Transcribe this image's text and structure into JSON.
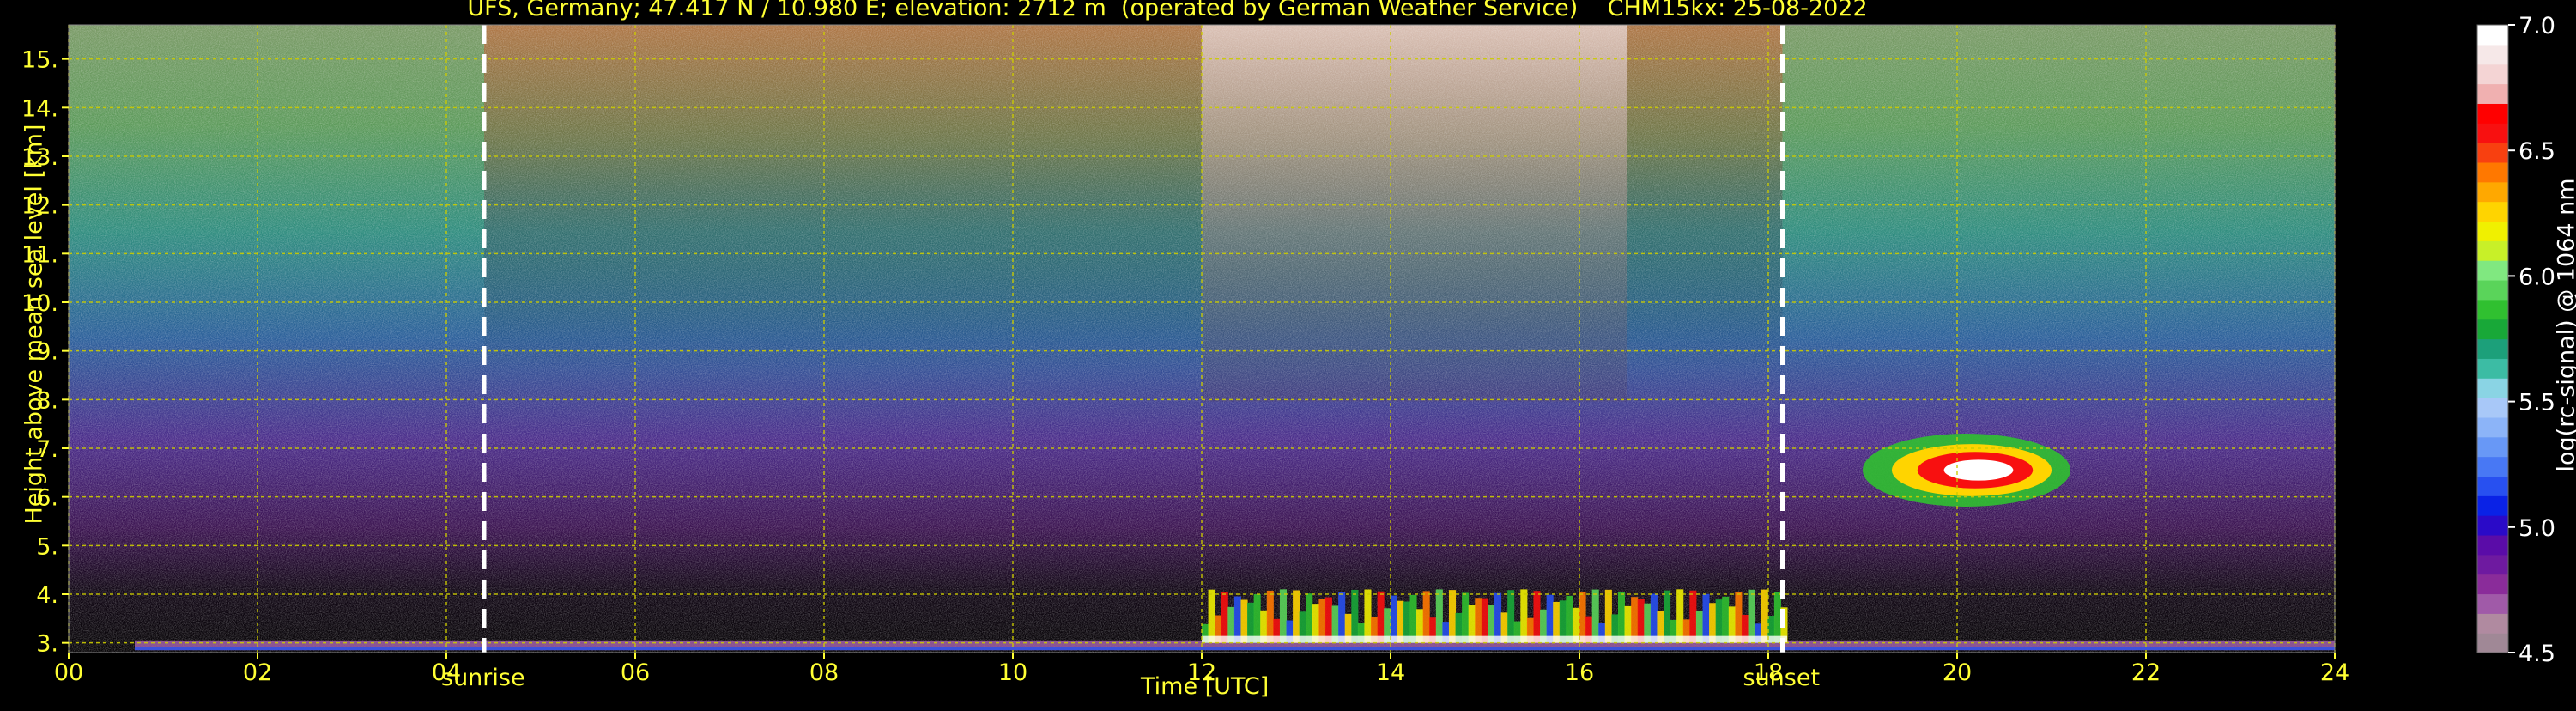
{
  "chart_data": {
    "type": "heatmap",
    "title": "UFS, Germany; 47.417 N / 10.980 E; elevation: 2712 m  (operated by German Weather Service)    CHM15kx: 25-08-2022",
    "xlabel": "Time [UTC]",
    "ylabel": "Height above mean sea level [km]",
    "colorbar_label": "log(rc-signal) @ 1064 nm",
    "x_range": [
      0,
      24
    ],
    "y_range": [
      2.8,
      15.7
    ],
    "x_ticks": [
      "00",
      "02",
      "04",
      "06",
      "08",
      "10",
      "12",
      "14",
      "16",
      "18",
      "20",
      "22",
      "24"
    ],
    "y_ticks": [
      "3.",
      "4.",
      "5.",
      "6.",
      "7.",
      "8.",
      "9.",
      "10.",
      "11.",
      "12.",
      "13.",
      "14.",
      "15."
    ],
    "colorbar_range": [
      4.5,
      7.0
    ],
    "colorbar_ticks": [
      "4.5",
      "5.0",
      "5.5",
      "6.0",
      "6.5",
      "7.0"
    ],
    "colorbar_colors": [
      "#a08896",
      "#b08aa0",
      "#a05aa8",
      "#8a2c9a",
      "#6e1aa0",
      "#5a0ca8",
      "#2a0ac8",
      "#0a22e6",
      "#2850f0",
      "#4878f4",
      "#6898f6",
      "#8cb4f8",
      "#a8c8f8",
      "#8ad4e4",
      "#3cbca4",
      "#1ca07a",
      "#18a838",
      "#30c030",
      "#5ad45a",
      "#80e880",
      "#c8f028",
      "#f0f000",
      "#ffd400",
      "#ffa800",
      "#ff7800",
      "#f84010",
      "#f81010",
      "#ff0000",
      "#f0b0b0",
      "#f4d4d4",
      "#f6e8e8",
      "#ffffff"
    ],
    "grid": true,
    "grid_color": "#cccc00",
    "sunrise": 4.4,
    "sunset": 18.15,
    "sunrise_label": "sunrise",
    "sunset_label": "sunset",
    "features": [
      {
        "name": "surface layer",
        "x": [
          0.7,
          24
        ],
        "y": [
          2.85,
          3.05
        ]
      },
      {
        "name": "convective boundary layer",
        "x": [
          12.0,
          18.2
        ],
        "y": [
          3.0,
          4.1
        ]
      },
      {
        "name": "elevated cloud",
        "x": [
          19.0,
          21.2
        ],
        "y": [
          5.8,
          7.3
        ]
      }
    ]
  }
}
